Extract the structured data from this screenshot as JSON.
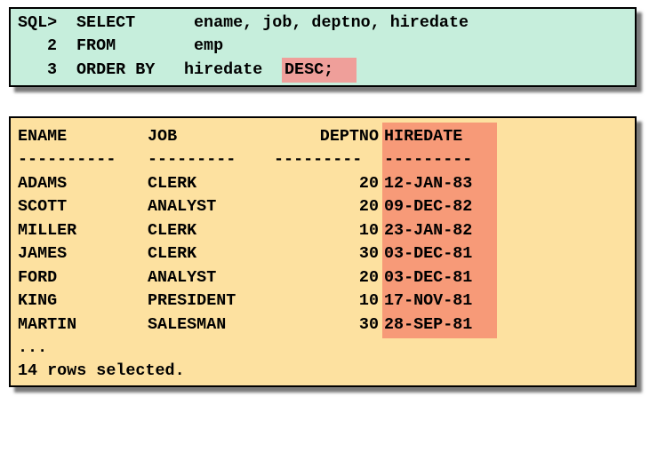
{
  "query": {
    "lines": [
      {
        "prompt": "SQL>",
        "keyword": "SELECT",
        "text": "ename, job, deptno, hiredate"
      },
      {
        "prompt": "2",
        "keyword": "FROM",
        "text": "emp"
      },
      {
        "prompt": "3",
        "keyword": "ORDER BY",
        "text": "hiredate",
        "highlight": "DESC;"
      }
    ],
    "highlight_color": "#ef9f9a"
  },
  "result": {
    "headers": [
      "ENAME",
      "JOB",
      "DEPTNO",
      "HIREDATE"
    ],
    "separators": [
      "----------",
      "---------",
      "---------",
      "---------"
    ],
    "rows": [
      [
        "ADAMS",
        "CLERK",
        "20",
        "12-JAN-83"
      ],
      [
        "SCOTT",
        "ANALYST",
        "20",
        "09-DEC-82"
      ],
      [
        "MILLER",
        "CLERK",
        "10",
        "23-JAN-82"
      ],
      [
        "JAMES",
        "CLERK",
        "30",
        "03-DEC-81"
      ],
      [
        "FORD",
        "ANALYST",
        "20",
        "03-DEC-81"
      ],
      [
        "KING",
        "PRESIDENT",
        "10",
        "17-NOV-81"
      ],
      [
        "MARTIN",
        "SALESMAN",
        "30",
        "28-SEP-81"
      ]
    ],
    "ellipsis": "...",
    "footer": "14 rows selected.",
    "highlight_color": "#f79a78"
  },
  "colors": {
    "sql_background": "#c6eedc",
    "result_background": "#fde1a0"
  }
}
